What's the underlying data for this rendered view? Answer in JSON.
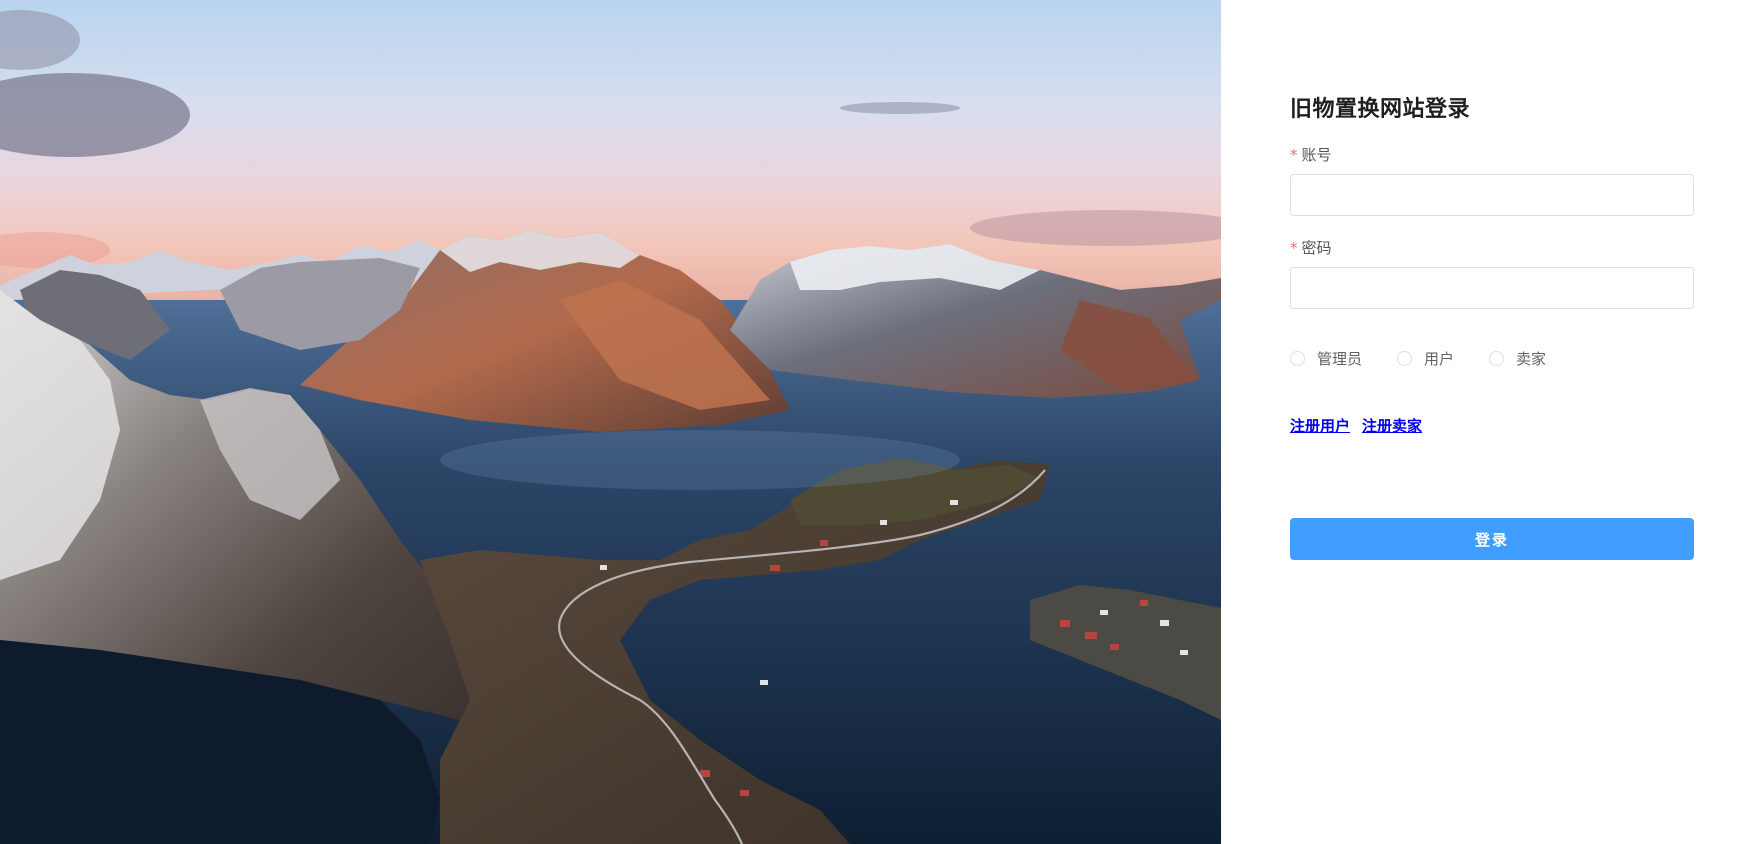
{
  "hero": {
    "image_icon": "mountain-fjord-landscape"
  },
  "login": {
    "title": "旧物置换网站登录",
    "required_mark": "*",
    "account": {
      "label": "账号",
      "value": "",
      "placeholder": ""
    },
    "password": {
      "label": "密码",
      "value": "",
      "placeholder": ""
    },
    "roles": [
      {
        "label": "管理员",
        "selected": false
      },
      {
        "label": "用户",
        "selected": false
      },
      {
        "label": "卖家",
        "selected": false
      }
    ],
    "links": {
      "register_user": "注册用户",
      "register_seller": "注册卖家"
    },
    "submit_label": "登录"
  },
  "colors": {
    "primary": "#409eff",
    "required": "#f56c6c",
    "link": "#0000ee",
    "title": "#1f1f1f"
  }
}
